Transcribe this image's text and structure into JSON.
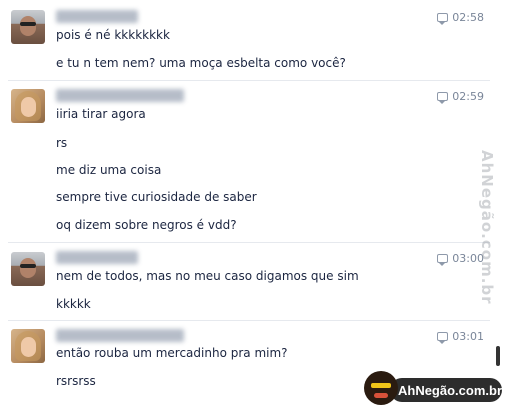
{
  "messages": [
    {
      "sender": "male",
      "time": "02:58",
      "lines": [
        "pois é né kkkkkkkk",
        "e tu n tem nem? uma moça esbelta como você?"
      ]
    },
    {
      "sender": "female",
      "time": "02:59",
      "lines": [
        "iiria tirar agora",
        "rs",
        "me diz uma coisa",
        "sempre tive curiosidade de saber",
        "oq dizem sobre negros é vdd?"
      ]
    },
    {
      "sender": "male",
      "time": "03:00",
      "lines": [
        "nem de todos, mas no meu caso digamos que sim",
        "kkkkk"
      ]
    },
    {
      "sender": "female",
      "time": "03:01",
      "lines": [
        "então rouba um mercadinho pra mim?",
        "rsrsrss"
      ]
    }
  ],
  "watermark": {
    "side_text": "AhNegão.com.br",
    "logo_text": "AhNegão.com.br"
  }
}
